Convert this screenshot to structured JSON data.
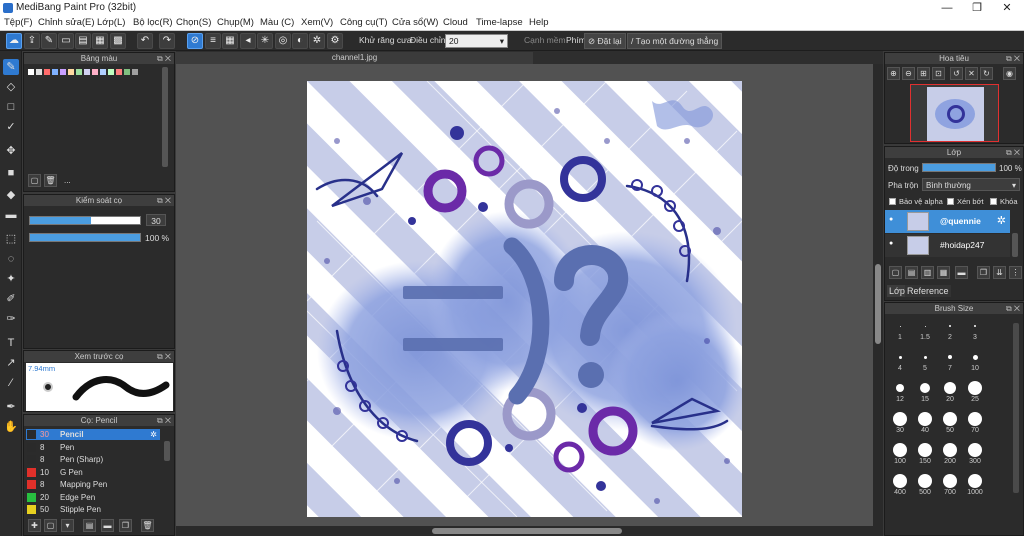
{
  "window": {
    "title": "MediBang Paint Pro (32bit)",
    "min": "—",
    "max": "❐",
    "close": "✕"
  },
  "menu": [
    "Tệp(F)",
    "Chỉnh sửa(E)",
    "Lớp(L)",
    "Bộ lọc(R)",
    "Chọn(S)",
    "Chụp(M)",
    "Màu (C)",
    "Xem(V)",
    "Công cụ(T)",
    "Cửa sổ(W)",
    "Cloud",
    "Time-lapse",
    "Help"
  ],
  "toolbar": {
    "antialias_label": "Khử răng cưa",
    "adjust_label": "Điều chỉnh",
    "adjust_value": "20",
    "smooth_label": "Cạnh mềm",
    "key_label": "Phím",
    "reset_label": "Đặt lại",
    "straight_label": "Tạo một đường thẳng"
  },
  "palette_panel": {
    "title": "Bảng màu",
    "add_label": "...",
    "colors": [
      "#ffffff",
      "#e0e0e0",
      "#ff6b6b",
      "#7fb1ff",
      "#c9a0ff",
      "#ffd9a0",
      "#a0e0a0",
      "#d0d0f0",
      "#ffb0c8",
      "#b0d0ff",
      "#c0ffc0",
      "#ff8080",
      "#80c080",
      "#a0a0a0"
    ]
  },
  "brush_control_panel": {
    "title": "Kiểm soát cọ",
    "size_value": "30",
    "opacity_value": "100 %",
    "size_fill": 0.55,
    "opacity_fill": 1.0
  },
  "brush_preview_panel": {
    "title": "Xem trước cọ",
    "size_label": "7.94mm"
  },
  "brush_list_panel": {
    "title": "Cọ: Pencil",
    "items": [
      {
        "size": "30",
        "name": "Pencil",
        "color": "#2a2a2a",
        "selected": true
      },
      {
        "size": "8",
        "name": "Pen",
        "color": "#2a2a2a",
        "selected": false
      },
      {
        "size": "8",
        "name": "Pen (Sharp)",
        "color": "#2a2a2a",
        "selected": false
      },
      {
        "size": "10",
        "name": "G Pen",
        "color": "#e0302a",
        "selected": false
      },
      {
        "size": "8",
        "name": "Mapping Pen",
        "color": "#e0302a",
        "selected": false
      },
      {
        "size": "20",
        "name": "Edge Pen",
        "color": "#28c040",
        "selected": false
      },
      {
        "size": "50",
        "name": "Stipple Pen",
        "color": "#e8d020",
        "selected": false
      }
    ]
  },
  "canvas": {
    "tab_name": "channel1.jpg"
  },
  "navigator_panel": {
    "title": "Hoa tiêu"
  },
  "layer_panel": {
    "title": "Lớp",
    "opacity_label": "Độ trong",
    "opacity_value": "100 %",
    "opacity_fill": 1.0,
    "blend_label": "Pha trộn",
    "blend_value": "Bình thường",
    "protect_alpha_label": "Bảo vệ alpha",
    "clipping_label": "Xén bớt",
    "lock_label": "Khóa",
    "layers": [
      {
        "name": "@quennie",
        "selected": true
      },
      {
        "name": "#hoidap247",
        "selected": false
      }
    ],
    "tabs": [
      "Lớp",
      "Reference"
    ]
  },
  "brush_size_panel": {
    "title": "Brush Size",
    "sizes": [
      "1",
      "1.5",
      "2",
      "3",
      "4",
      "5",
      "7",
      "10",
      "12",
      "15",
      "20",
      "25",
      "30",
      "40",
      "50",
      "70",
      "100",
      "150",
      "200",
      "300",
      "400",
      "500",
      "700",
      "1000"
    ]
  }
}
